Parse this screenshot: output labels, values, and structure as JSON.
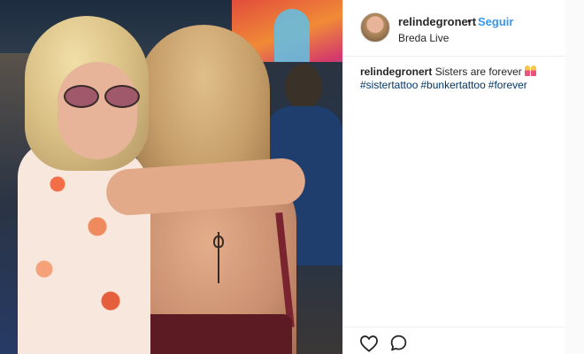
{
  "post": {
    "username": "relindegronert",
    "separator": "•",
    "follow_label": "Seguir",
    "location": "Breda Live",
    "caption": {
      "username": "relindegronert",
      "text": "Sisters are forever",
      "emoji": "sisters-emoji",
      "hashtags": [
        "#sistertattoo",
        "#bunkertattoo",
        "#forever"
      ]
    },
    "actions": {
      "like_icon": "heart-icon",
      "comment_icon": "comment-icon"
    }
  },
  "colors": {
    "link_blue": "#3897f0",
    "hashtag_blue": "#003569",
    "text": "#262626",
    "border": "#efefef"
  }
}
